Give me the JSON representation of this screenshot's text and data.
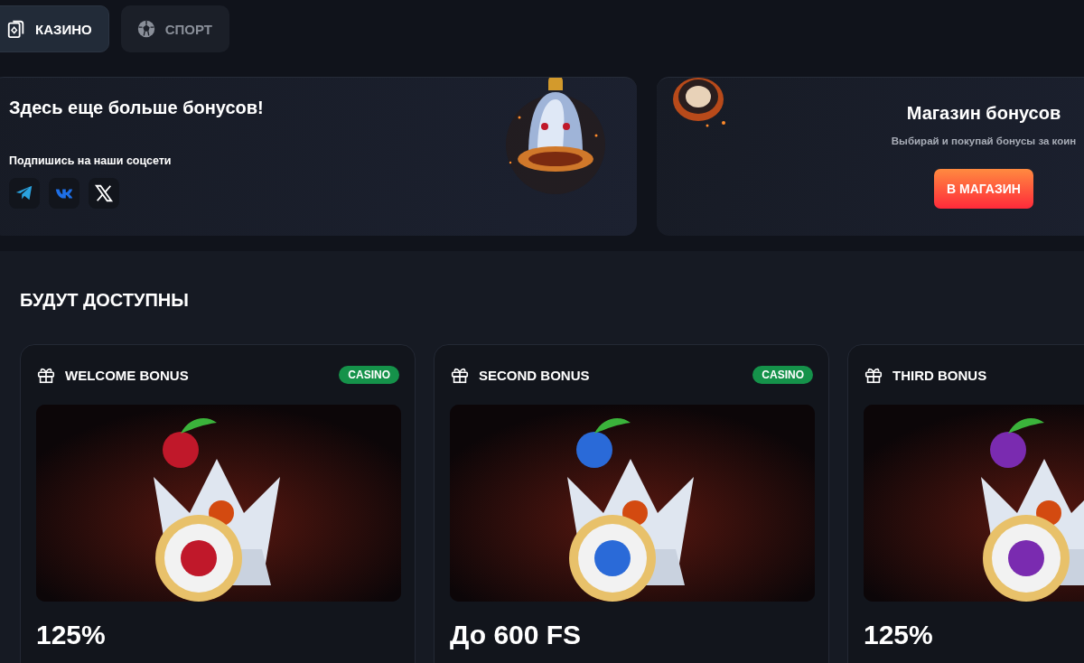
{
  "tabs": [
    {
      "label": "КАЗИНО",
      "kind": "cards",
      "selected": true
    },
    {
      "label": "СПОРТ",
      "kind": "ball",
      "selected": false
    }
  ],
  "social_banner": {
    "title": "Здесь еще больше бонусов!",
    "subtitle": "Подпишись на наши соцсети",
    "links": [
      {
        "kind": "telegram"
      },
      {
        "kind": "vk"
      },
      {
        "kind": "x"
      }
    ]
  },
  "shop_banner": {
    "title": "Магазин бонусов",
    "subtitle": "Выбирай и покупай бонусы за коин",
    "button": "В МАГАЗИН"
  },
  "section": {
    "title": "БУДУТ ДОСТУПНЫ",
    "cards": [
      {
        "title": "WELCOME BONUS",
        "badge": "CASINO",
        "value": "125%"
      },
      {
        "title": "SECOND BONUS",
        "badge": "CASINO",
        "value": "До 600 FS"
      },
      {
        "title": "THIRD BONUS",
        "value": "125%"
      }
    ]
  }
}
